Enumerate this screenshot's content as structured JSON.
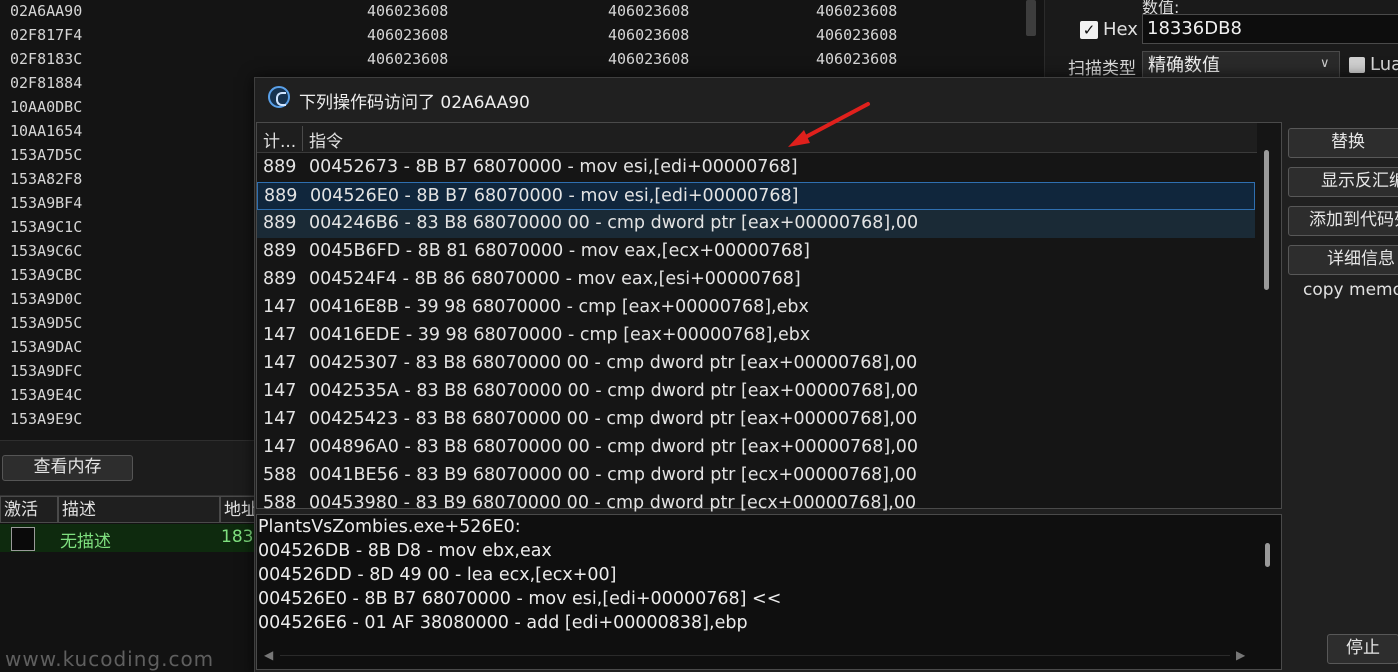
{
  "address_list": {
    "rows": [
      {
        "address": "02A6AA90",
        "v1": "406023608",
        "v2": "406023608",
        "v3": "406023608"
      },
      {
        "address": "02F817F4",
        "v1": "406023608",
        "v2": "406023608",
        "v3": "406023608"
      },
      {
        "address": "02F8183C",
        "v1": "406023608",
        "v2": "406023608",
        "v3": "406023608"
      },
      {
        "address": "02F81884",
        "v1": "",
        "v2": "",
        "v3": ""
      },
      {
        "address": "10AA0DBC",
        "v1": "",
        "v2": "",
        "v3": ""
      },
      {
        "address": "10AA1654",
        "v1": "",
        "v2": "",
        "v3": ""
      },
      {
        "address": "153A7D5C",
        "v1": "",
        "v2": "",
        "v3": ""
      },
      {
        "address": "153A82F8",
        "v1": "",
        "v2": "",
        "v3": ""
      },
      {
        "address": "153A9BF4",
        "v1": "",
        "v2": "",
        "v3": ""
      },
      {
        "address": "153A9C1C",
        "v1": "",
        "v2": "",
        "v3": ""
      },
      {
        "address": "153A9C6C",
        "v1": "",
        "v2": "",
        "v3": ""
      },
      {
        "address": "153A9CBC",
        "v1": "",
        "v2": "",
        "v3": ""
      },
      {
        "address": "153A9D0C",
        "v1": "",
        "v2": "",
        "v3": ""
      },
      {
        "address": "153A9D5C",
        "v1": "",
        "v2": "",
        "v3": ""
      },
      {
        "address": "153A9DAC",
        "v1": "",
        "v2": "",
        "v3": ""
      },
      {
        "address": "153A9DFC",
        "v1": "",
        "v2": "",
        "v3": ""
      },
      {
        "address": "153A9E4C",
        "v1": "",
        "v2": "",
        "v3": ""
      },
      {
        "address": "153A9E9C",
        "v1": "",
        "v2": "",
        "v3": ""
      }
    ]
  },
  "scan_panel": {
    "value_label": "数值:",
    "hex_label": "Hex",
    "hex_checked": "✓",
    "value_input": "18336DB8",
    "scan_type_label": "扫描类型",
    "scan_type_value": "精确数值",
    "lua_label": "Lua"
  },
  "view_memory_button": "查看内存",
  "cheat_table": {
    "headers": {
      "active": "激活",
      "description": "描述",
      "address": "地址"
    },
    "row": {
      "description": "无描述",
      "address": "183"
    }
  },
  "watermark": "www.kucoding.com",
  "dialog": {
    "title": "下列操作码访问了 02A6AA90",
    "header_count": "计...",
    "header_instruction": "指令",
    "rows": [
      {
        "count": "889",
        "text": "00452673 - 8B B7 68070000  - mov esi,[edi+00000768]"
      },
      {
        "count": "889",
        "text": "004526E0 - 8B B7 68070000  - mov esi,[edi+00000768]"
      },
      {
        "count": "889",
        "text": "004246B6 - 83 B8 68070000 00 - cmp dword ptr [eax+00000768],00"
      },
      {
        "count": "889",
        "text": "0045B6FD - 8B 81 68070000  - mov eax,[ecx+00000768]"
      },
      {
        "count": "889",
        "text": "004524F4 - 8B 86 68070000  - mov eax,[esi+00000768]"
      },
      {
        "count": "147",
        "text": "00416E8B - 39 98 68070000  - cmp [eax+00000768],ebx"
      },
      {
        "count": "147",
        "text": "00416EDE - 39 98 68070000  - cmp [eax+00000768],ebx"
      },
      {
        "count": "147",
        "text": "00425307 - 83 B8 68070000 00 - cmp dword ptr [eax+00000768],00"
      },
      {
        "count": "147",
        "text": "0042535A - 83 B8 68070000 00 - cmp dword ptr [eax+00000768],00"
      },
      {
        "count": "147",
        "text": "00425423 - 83 B8 68070000 00 - cmp dword ptr [eax+00000768],00"
      },
      {
        "count": "147",
        "text": "004896A0 - 83 B8 68070000 00 - cmp dword ptr [eax+00000768],00"
      },
      {
        "count": "588",
        "text": "0041BE56 - 83 B9 68070000 00 - cmp dword ptr [ecx+00000768],00"
      },
      {
        "count": "588",
        "text": "00453980 - 83 B9 68070000 00 - cmp dword ptr [ecx+00000768],00"
      }
    ],
    "disassembly": [
      "PlantsVsZombies.exe+526E0:",
      "004526DB - 8B D8  - mov ebx,eax",
      "004526DD - 8D 49 00  - lea ecx,[ecx+00]",
      "004526E0 - 8B B7 68070000  - mov esi,[edi+00000768] <<",
      "004526E6 - 01 AF 38080000  - add [edi+00000838],ebp"
    ],
    "buttons": {
      "replace": "替换",
      "show_disassembler": "显示反汇编程序",
      "add_to_codelist": "添加到代码列表",
      "more_info": "详细信息",
      "copy_memory": "copy memory",
      "stop": "停止"
    },
    "arrow_color": "#e0201c"
  }
}
